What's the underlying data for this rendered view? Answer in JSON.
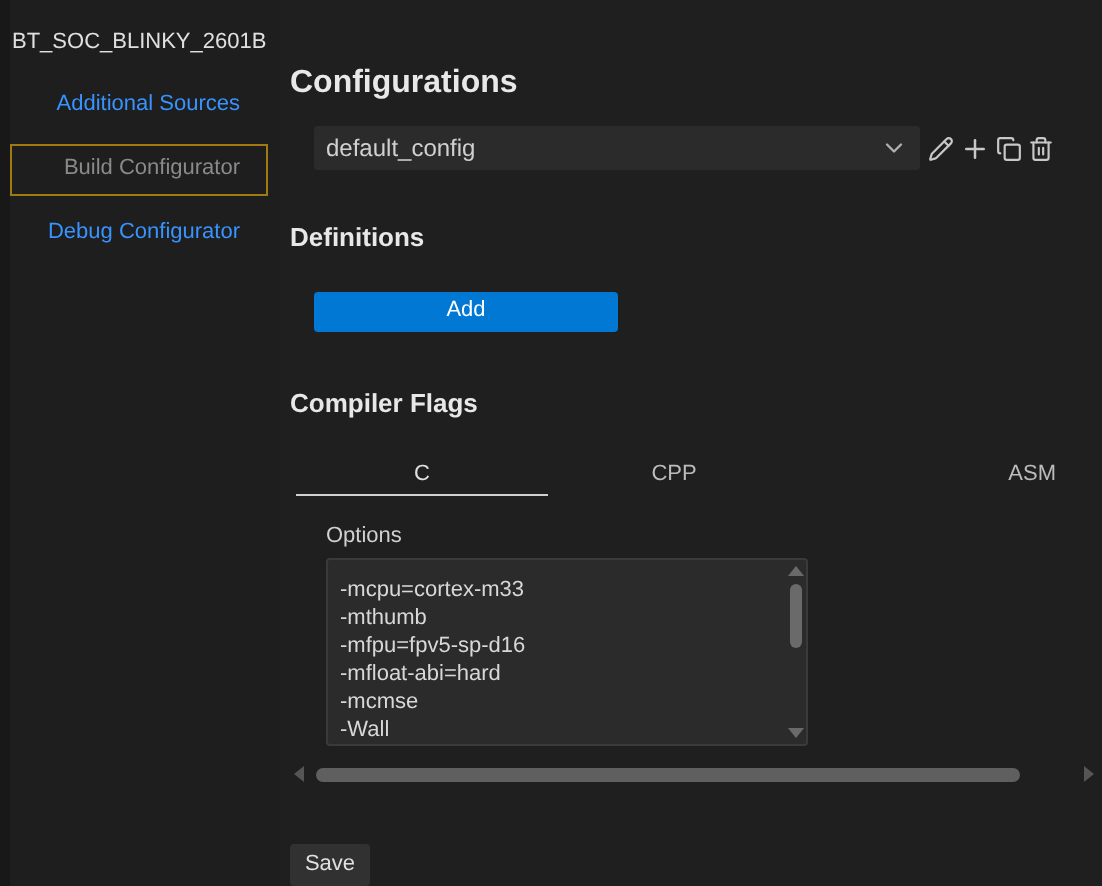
{
  "project": {
    "title": "BT_SOC_BLINKY_2601B"
  },
  "sidebar": {
    "items": [
      {
        "label": "Additional Sources",
        "selected": false
      },
      {
        "label": "Build Configurator",
        "selected": true
      },
      {
        "label": "Debug Configurator",
        "selected": false
      }
    ]
  },
  "configurations": {
    "title": "Configurations",
    "value": "default_config"
  },
  "definitions": {
    "title": "Definitions",
    "add_button": "Add"
  },
  "compiler_flags": {
    "title": "Compiler Flags",
    "tabs": [
      {
        "label": "C",
        "selected": true
      },
      {
        "label": "CPP",
        "selected": false
      },
      {
        "label": "ASM",
        "selected": false
      }
    ],
    "options_label": "Options",
    "options": [
      "-mcpu=cortex-m33",
      "-mthumb",
      "-mfpu=fpv5-sp-d16",
      "-mfloat-abi=hard",
      "-mcmse",
      "-Wall"
    ]
  },
  "save_button": "Save"
}
